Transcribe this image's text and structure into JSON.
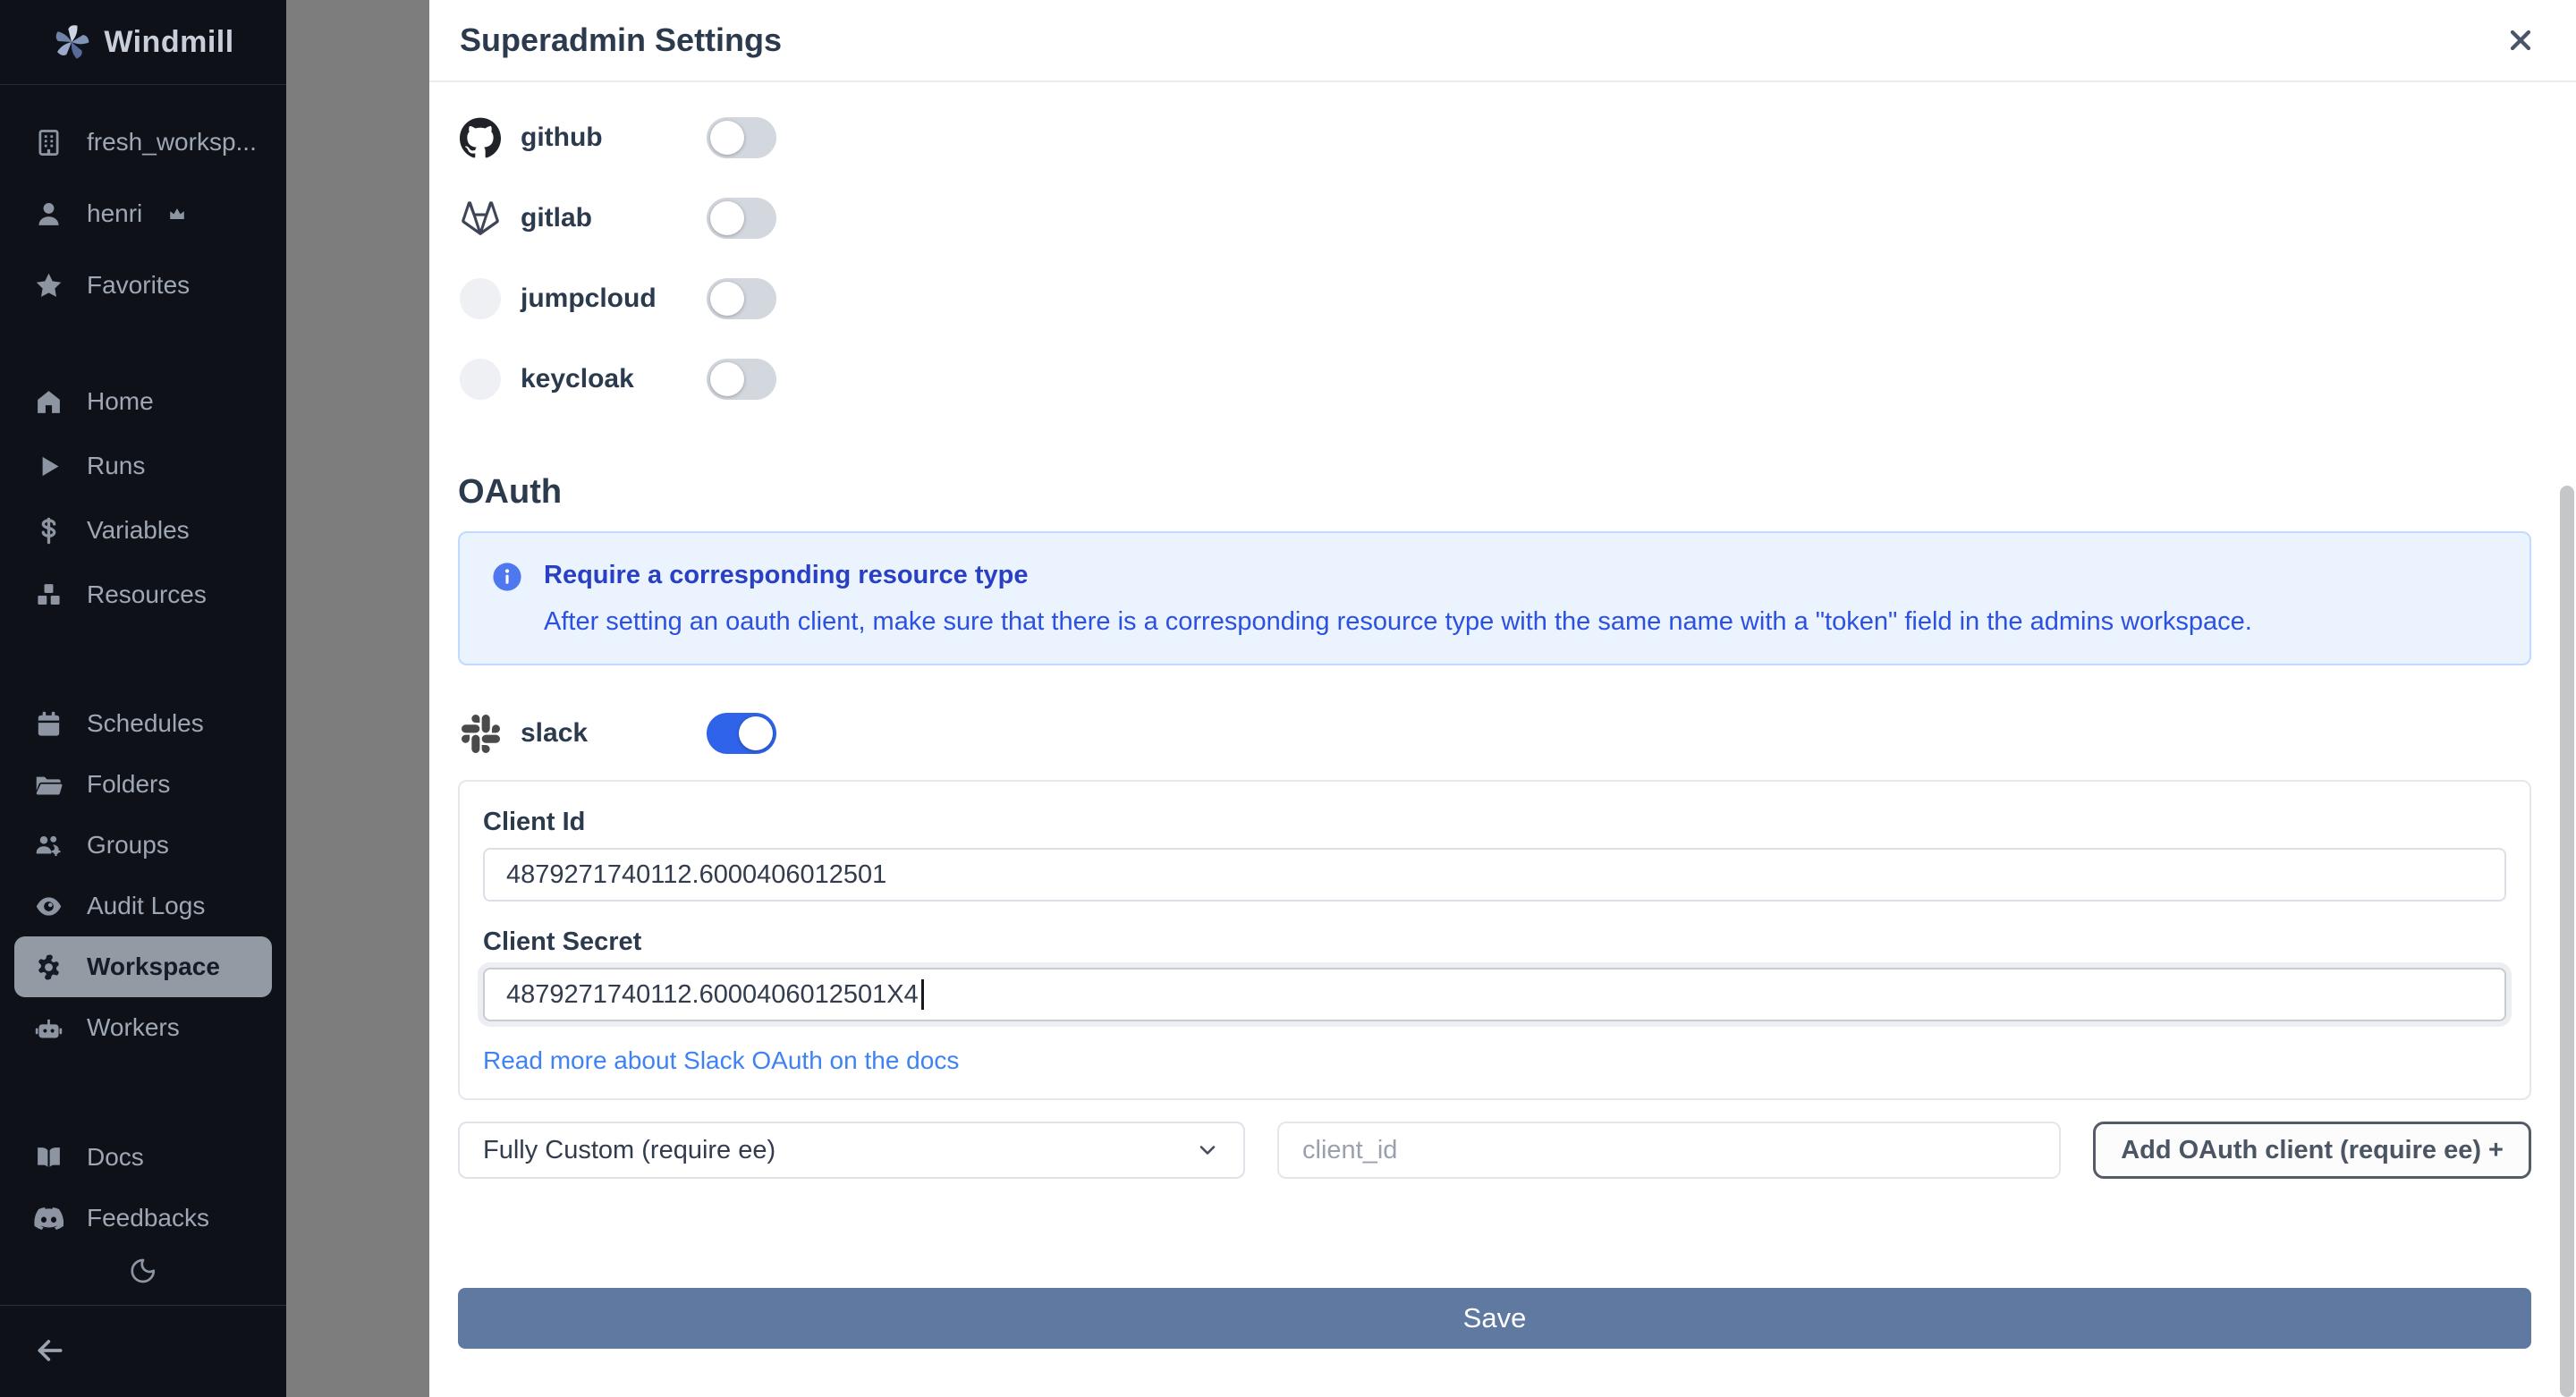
{
  "sidebar": {
    "logo": "Windmill",
    "workspace": "fresh_worksp...",
    "user": "henri",
    "favorites": "Favorites",
    "nav_main": [
      "Home",
      "Runs",
      "Variables",
      "Resources"
    ],
    "nav_admin": [
      "Schedules",
      "Folders",
      "Groups",
      "Audit Logs",
      "Workspace",
      "Workers"
    ],
    "nav_footer": [
      "Docs",
      "Feedbacks"
    ]
  },
  "drawer": {
    "title": "Superadmin Settings",
    "sso": [
      {
        "name": "github",
        "enabled": false
      },
      {
        "name": "gitlab",
        "enabled": false
      },
      {
        "name": "jumpcloud",
        "enabled": false
      },
      {
        "name": "keycloak",
        "enabled": false
      }
    ],
    "oauth": {
      "heading": "OAuth",
      "info_title": "Require a corresponding resource type",
      "info_body": "After setting an oauth client, make sure that there is a corresponding resource type with the same name with a \"token\" field in the admins workspace.",
      "slack": {
        "name": "slack",
        "enabled": true,
        "client_id_label": "Client Id",
        "client_id_value": "4879271740112.6000406012501",
        "client_secret_label": "Client Secret",
        "client_secret_value": "4879271740112.6000406012501X4",
        "docs_link": "Read more about Slack OAuth on the docs"
      },
      "custom": {
        "select_value": "Fully Custom (require ee)",
        "client_id_placeholder": "client_id",
        "add_button": "Add OAuth client (require ee) +"
      }
    },
    "save_label": "Save"
  },
  "colors": {
    "toggle_on": "#2f63e9",
    "save_button": "#5f79a1",
    "info_bg": "#ebf3fe",
    "info_text": "#2c50e1",
    "link": "#3e82f5",
    "sidebar_bg": "#0e1218"
  }
}
